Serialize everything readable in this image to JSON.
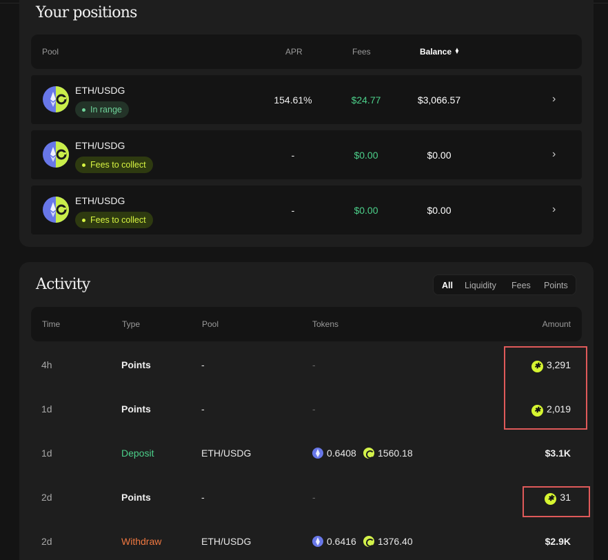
{
  "positions": {
    "title": "Your positions",
    "headers": {
      "pool": "Pool",
      "apr": "APR",
      "fees": "Fees",
      "balance": "Balance"
    },
    "rows": [
      {
        "pair": "ETH/USDG",
        "status": "In range",
        "apr": "154.61%",
        "fees": "$24.77",
        "balance": "$3,066.57"
      },
      {
        "pair": "ETH/USDG",
        "status": "Fees to collect",
        "apr": "-",
        "fees": "$0.00",
        "balance": "$0.00"
      },
      {
        "pair": "ETH/USDG",
        "status": "Fees to collect",
        "apr": "-",
        "fees": "$0.00",
        "balance": "$0.00"
      }
    ]
  },
  "activity": {
    "title": "Activity",
    "filters": [
      "All",
      "Liquidity",
      "Fees",
      "Points"
    ],
    "active_filter": "All",
    "headers": {
      "time": "Time",
      "type": "Type",
      "pool": "Pool",
      "tokens": "Tokens",
      "amount": "Amount"
    },
    "rows": [
      {
        "time": "4h",
        "type": "Points",
        "pool": "-",
        "tokens": "-",
        "amount": "3,291"
      },
      {
        "time": "1d",
        "type": "Points",
        "pool": "-",
        "tokens": "-",
        "amount": "2,019"
      },
      {
        "time": "1d",
        "type": "Deposit",
        "pool": "ETH/USDG",
        "eth_amount": "0.6408",
        "usdg_amount": "1560.18",
        "amount": "$3.1K"
      },
      {
        "time": "2d",
        "type": "Points",
        "pool": "-",
        "tokens": "-",
        "amount": "31"
      },
      {
        "time": "2d",
        "type": "Withdraw",
        "pool": "ETH/USDG",
        "eth_amount": "0.6416",
        "usdg_amount": "1376.40",
        "amount": "$2.9K"
      }
    ]
  },
  "colors": {
    "background": "#141414",
    "card": "#1e1e1e",
    "positive": "#4cd08a",
    "withdraw": "#f07840",
    "points_accent": "#d6f531",
    "highlight_box": "#e05a5a"
  },
  "icons": {
    "pair": "eth-usdg-pair-icon",
    "eth": "eth-token-icon",
    "usdg": "usdg-token-icon",
    "points": "points-star-icon",
    "chevron": "chevron-right-icon",
    "sort": "sort-icon"
  }
}
